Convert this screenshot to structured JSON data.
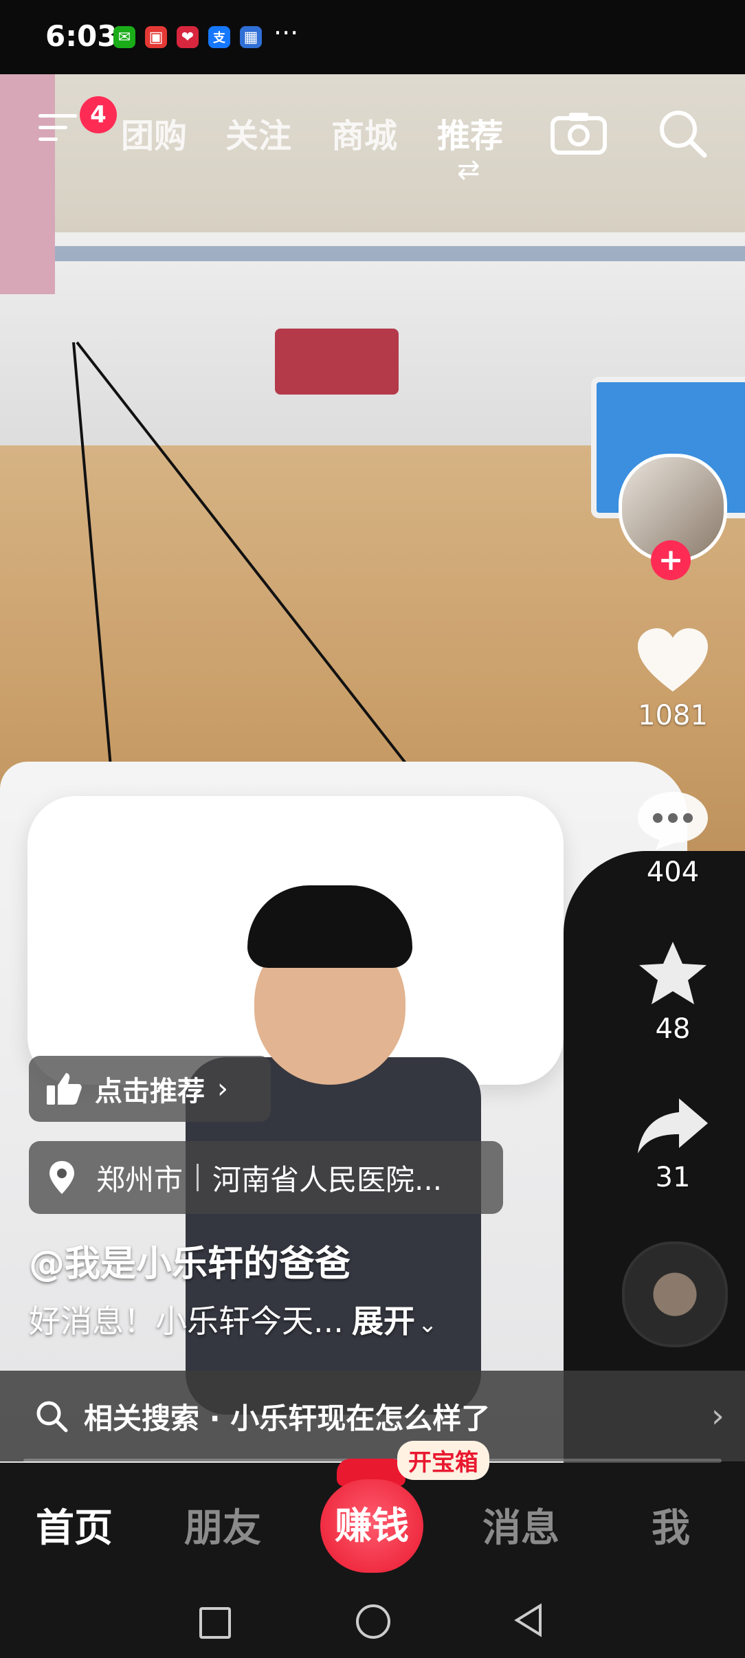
{
  "status_bar": {
    "time": "6:03",
    "app_icons": [
      {
        "name": "wechat-icon",
        "color": "#1aad19",
        "glyph": "✉"
      },
      {
        "name": "red-app-icon",
        "color": "#e53935",
        "glyph": "▣"
      },
      {
        "name": "heart-app-icon",
        "color": "#d7263d",
        "glyph": "❤"
      },
      {
        "name": "alipay-icon",
        "color": "#1677ff",
        "glyph": "支"
      },
      {
        "name": "calendar-app-icon",
        "color": "#2f6fd6",
        "glyph": "▦"
      }
    ],
    "more": "···"
  },
  "top_nav": {
    "notification_count": "4",
    "tabs": [
      "团购",
      "关注",
      "商城",
      "推荐"
    ],
    "active_tab": "推荐"
  },
  "right_rail": {
    "like_count": "1081",
    "comment_count": "404",
    "favorite_count": "48",
    "share_count": "31"
  },
  "video_info": {
    "recommend_label": "点击推荐",
    "city": "郑州市",
    "location": "河南省人民医院...",
    "author": "@我是小乐轩的爸爸",
    "description": "好消息！小乐轩今天...",
    "expand_label": "展开"
  },
  "related_search": {
    "label": "相关搜索 · 小乐轩现在怎么样了"
  },
  "bottom_nav": {
    "home": "首页",
    "friends": "朋友",
    "earn": "赚钱",
    "treasure_box": "开宝箱",
    "messages": "消息",
    "me": "我"
  },
  "colors": {
    "accent": "#fe2c55",
    "earn_red": "#e9192f"
  }
}
